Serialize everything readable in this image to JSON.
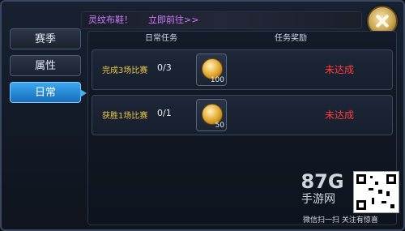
{
  "header": {
    "promo": "灵纹布鞋！",
    "link": "立即前往>>"
  },
  "sidebar": {
    "tabs": [
      {
        "label": "赛季"
      },
      {
        "label": "属性"
      },
      {
        "label": "日常"
      }
    ]
  },
  "table": {
    "columns": [
      "日常任务",
      "任务奖励"
    ],
    "rows": [
      {
        "name": "完成3场比赛",
        "progress": "0/3",
        "reward_count": "100",
        "status": "未达成"
      },
      {
        "name": "获胜1场比赛",
        "progress": "0/1",
        "reward_count": "50",
        "status": "未达成"
      }
    ]
  },
  "watermark": {
    "logo": "87G",
    "sub": "手游网",
    "caption": "微信扫一扫 关注有惊喜"
  },
  "icons": {
    "close": "close-icon",
    "coin": "coin-icon",
    "qr": "qr-code-icon"
  },
  "colors": {
    "accent": "#3aa8f0",
    "status": "#ff3b3b",
    "task_name": "#e7c647",
    "promo": "#d07bff"
  }
}
